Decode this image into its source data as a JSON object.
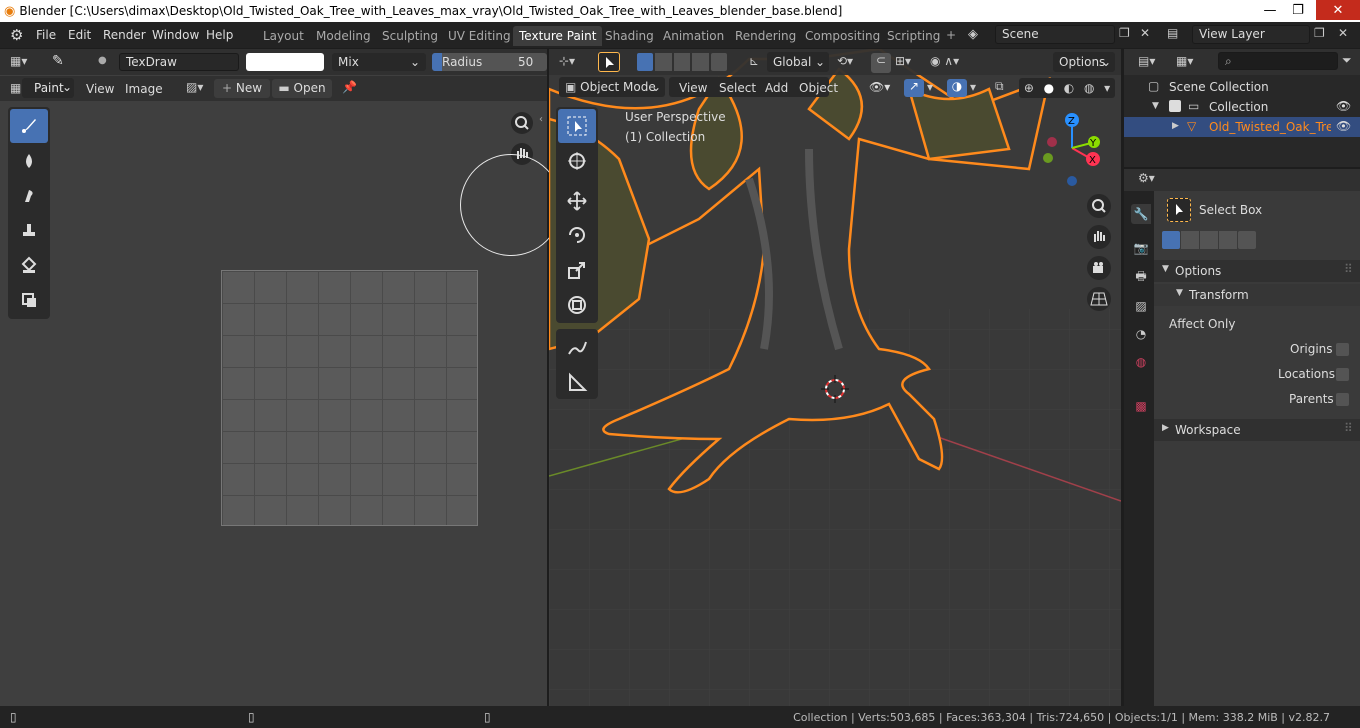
{
  "window": {
    "title": "Blender [C:\\Users\\dimax\\Desktop\\Old_Twisted_Oak_Tree_with_Leaves_max_vray\\Old_Twisted_Oak_Tree_with_Leaves_blender_base.blend]"
  },
  "menu": [
    "File",
    "Edit",
    "Render",
    "Window",
    "Help"
  ],
  "workspaces": [
    "Layout",
    "Modeling",
    "Sculpting",
    "UV Editing",
    "Texture Paint",
    "Shading",
    "Animation",
    "Rendering",
    "Compositing",
    "Scripting"
  ],
  "active_workspace": "Texture Paint",
  "scene": "Scene",
  "view_layer": "View Layer",
  "image_editor": {
    "brush": "TexDraw",
    "blend": "Mix",
    "radius_label": "Radius",
    "radius_value": "50 px",
    "mode": "Paint",
    "view": "View",
    "image": "Image",
    "new": "New",
    "open": "Open"
  },
  "viewport": {
    "mode": "Object Mode",
    "menus": [
      "View",
      "Select",
      "Add",
      "Object"
    ],
    "orientation": "Global",
    "options": "Options",
    "overlay_line1": "User Perspective",
    "overlay_line2": "(1) Collection",
    "axes": {
      "x": "X",
      "y": "Y",
      "z": "Z"
    }
  },
  "outliner": {
    "scene_collection": "Scene Collection",
    "collection": "Collection",
    "object": "Old_Twisted_Oak_Tree_w"
  },
  "properties": {
    "tool": "Select Box",
    "options": "Options",
    "transform": "Transform",
    "affect_only": "Affect Only",
    "origins": "Origins",
    "locations": "Locations",
    "parents": "Parents",
    "workspace": "Workspace"
  },
  "status": {
    "text": "Collection | Verts:503,685 | Faces:363,304 | Tris:724,650 | Objects:1/1 | Mem: 338.2 MiB | v2.82.7"
  },
  "colors": {
    "accent": "#4772b3",
    "selection": "#ff8a1c",
    "x_axis": "#ff3352",
    "y_axis": "#8bdc00",
    "z_axis": "#2890ff"
  }
}
